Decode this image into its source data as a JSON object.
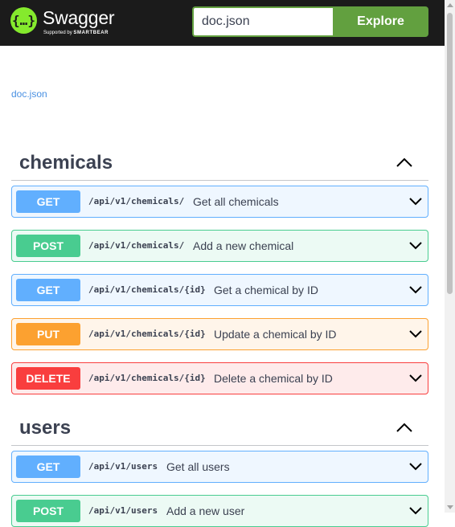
{
  "header": {
    "brand": "Swagger",
    "tagline_prefix": "Supported by",
    "tagline_brand": "SMARTBEAR",
    "url_value": "doc.json",
    "explore_label": "Explore"
  },
  "spec_link": "doc.json",
  "colors": {
    "topbar": "#1b1b1b",
    "logo": "#85ea2d",
    "explore": "#62a03f",
    "get": "#61affe",
    "post": "#49cc90",
    "put": "#fca130",
    "delete": "#f93e3e"
  },
  "tags": [
    {
      "name": "chemicals",
      "toggle_icon": "chevron-up-icon",
      "operations": [
        {
          "method": "GET",
          "path": "/api/v1/chemicals/",
          "summary": "Get all chemicals"
        },
        {
          "method": "POST",
          "path": "/api/v1/chemicals/",
          "summary": "Add a new chemical"
        },
        {
          "method": "GET",
          "path": "/api/v1/chemicals/{id}",
          "summary": "Get a chemical by ID"
        },
        {
          "method": "PUT",
          "path": "/api/v1/chemicals/{id}",
          "summary": "Update a chemical by ID"
        },
        {
          "method": "DELETE",
          "path": "/api/v1/chemicals/{id}",
          "summary": "Delete a chemical by ID"
        }
      ]
    },
    {
      "name": "users",
      "toggle_icon": "chevron-up-icon",
      "operations": [
        {
          "method": "GET",
          "path": "/api/v1/users",
          "summary": "Get all users"
        },
        {
          "method": "POST",
          "path": "/api/v1/users",
          "summary": "Add a new user"
        }
      ]
    }
  ]
}
